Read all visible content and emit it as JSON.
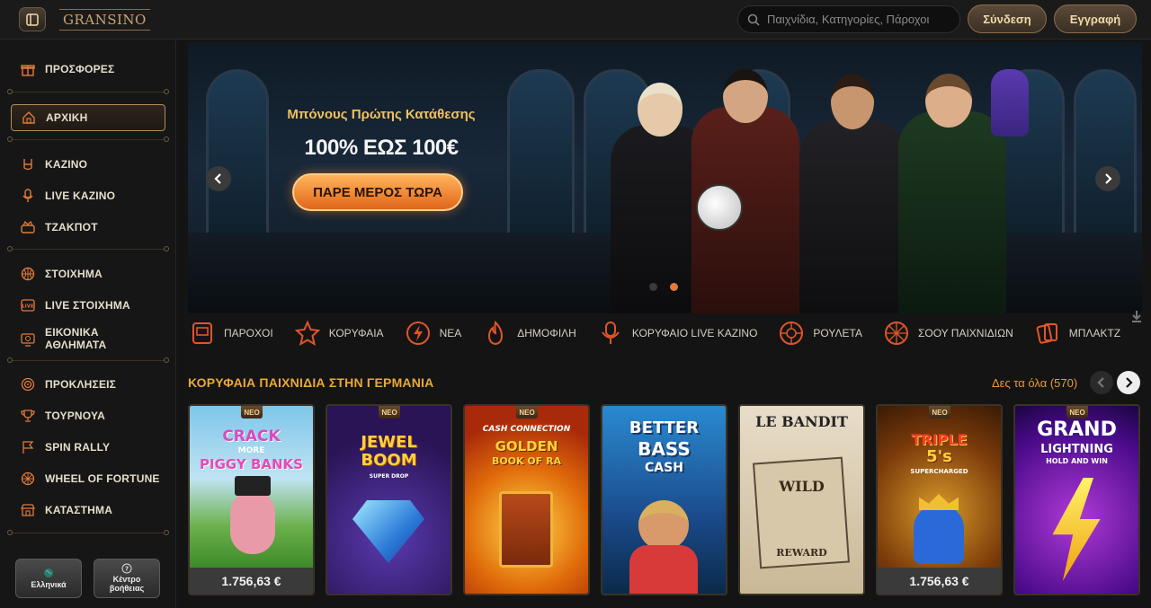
{
  "header": {
    "logo_text": "GRANSINO",
    "search_placeholder": "Παιχνίδια, Κατηγορίες, Πάροχοι",
    "login_label": "Σύνδεση",
    "register_label": "Εγγραφή"
  },
  "sidebar": {
    "items": [
      {
        "label": "ΠΡΟΣΦΟΡΕΣ",
        "icon": "gift-icon"
      },
      {
        "label": "ΑΡΧΙΚΗ",
        "icon": "home-icon",
        "active": true
      },
      {
        "label": "ΚΑΖΙΝΟ",
        "icon": "rock-hand-icon"
      },
      {
        "label": "LIVE ΚΑΖΙΝΟ",
        "icon": "microphone-icon"
      },
      {
        "label": "ΤΖΑΚΠΟΤ",
        "icon": "jackpot-icon"
      },
      {
        "label": "ΣΤΟΙΧΗΜΑ",
        "icon": "basketball-icon"
      },
      {
        "label": "LIVE ΣΤΟΙΧΗΜΑ",
        "icon": "live-badge-icon"
      },
      {
        "label": "ΕΙΚΟΝΙΚΑ ΑΘΛΗΜΑΤΑ",
        "icon": "virtual-sports-icon"
      },
      {
        "label": "ΠΡΟΚΛΗΣΕΙΣ",
        "icon": "target-icon"
      },
      {
        "label": "ΤΟΥΡΝΟΥΑ",
        "icon": "trophy-icon"
      },
      {
        "label": "SPIN RALLY",
        "icon": "flag-icon"
      },
      {
        "label": "WHEEL OF FORTUNE",
        "icon": "wheel-icon"
      },
      {
        "label": "ΚΑΤΑΣΤΗΜΑ",
        "icon": "store-icon"
      }
    ],
    "language_label": "Ελληνικά",
    "help_label_1": "Κέντρο",
    "help_label_2": "βοήθειας"
  },
  "banner": {
    "title": "Μπόνους Πρώτης Κατάθεσης",
    "offer": "100% ΕΩΣ 100€",
    "cta": "ΠΑΡΕ ΜΕΡΟΣ ΤΩΡΑ",
    "slides": 2,
    "active_slide": 2
  },
  "categories": [
    {
      "label": "ΠΑΡΟΧΟΙ",
      "icon": "slot-machine-icon"
    },
    {
      "label": "ΚΟΡΥΦΑΙΑ",
      "icon": "star-icon"
    },
    {
      "label": "ΝΕΑ",
      "icon": "lightning-icon"
    },
    {
      "label": "ΔΗΜΟΦΙΛΗ",
      "icon": "fire-icon"
    },
    {
      "label": "ΚΟΡΥΦΑΙΟ LIVE ΚΑΖΙΝΟ",
      "icon": "microphone-icon"
    },
    {
      "label": "ΡΟΥΛΕΤΑ",
      "icon": "roulette-icon"
    },
    {
      "label": "ΣΟΟΥ ΠΑΙΧΝΙΔΙΩΝ",
      "icon": "wheel-icon"
    },
    {
      "label": "ΜΠΛΑΚΤΖ",
      "icon": "cards-icon"
    }
  ],
  "games_section": {
    "title": "ΚΟΡΥΦΑΙΑ ΠΑΙΧΝΙΔΙΑ ΣΤΗΝ ΓΕΡΜΑΝΙΑ",
    "see_all": "Δες τα όλα (570)",
    "new_badge": "ΝΕΟ",
    "games": [
      {
        "t1": "CRACK",
        "t2": "MORE",
        "t3": "PIGGY BANKS",
        "price": "1.756,63 €",
        "new": true
      },
      {
        "t1": "JEWEL",
        "t2": "BOOM",
        "t3": "SUPER DROP",
        "price": "",
        "new": true
      },
      {
        "t1": "CASH CONNECTION",
        "t2": "GOLDEN",
        "t3": "BOOK OF RA",
        "price": "",
        "new": true
      },
      {
        "t1": "BETTER",
        "t2": "BASS",
        "t3": "CASH",
        "price": "",
        "new": false
      },
      {
        "t1": "LE BANDIT",
        "t2": "WILD",
        "t3": "REWARD",
        "price": "",
        "new": false
      },
      {
        "t1": "TRIPLE",
        "t2": "5's",
        "t3": "SUPERCHARGED",
        "price": "1.756,63 €",
        "new": true
      },
      {
        "t1": "GRAND",
        "t2": "LIGHTNING",
        "t3": "HOLD AND WIN",
        "price": "",
        "new": true
      }
    ]
  }
}
